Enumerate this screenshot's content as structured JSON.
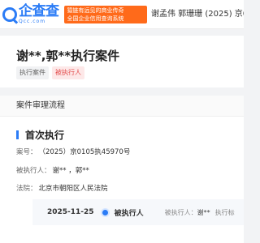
{
  "header": {
    "logo_name": "企查查",
    "logo_domain": "Qcc.com",
    "slogan_line1": "猿链有远见的商业传奇",
    "slogan_line2": "全国企业信用查询系统",
    "title": "谢孟伟  郭珊珊    (2025)  京010"
  },
  "case": {
    "title": "谢**,郭**执行案件",
    "tags": [
      "执行案件",
      "被执行人"
    ]
  },
  "process": {
    "section_title": "案件审理流程",
    "stage_title": "首次执行",
    "case_no_label": "案号：",
    "case_no_value": "（2025）京0105执45970号",
    "executed_label": "被执行人：",
    "executed_value": "谢**  ，郭**",
    "court_label": "法院：",
    "court_value": "北京市朝阳区人民法院",
    "timeline": {
      "date": "2025-11-25",
      "role": "被执行人",
      "detail_label": "被执行人：",
      "detail_value": "谢**",
      "more": "执行标"
    }
  },
  "colors": {
    "brand": "#2b7cf6",
    "slogan_bg": "#ff6a1a",
    "tag_red": "#e34b4b"
  }
}
